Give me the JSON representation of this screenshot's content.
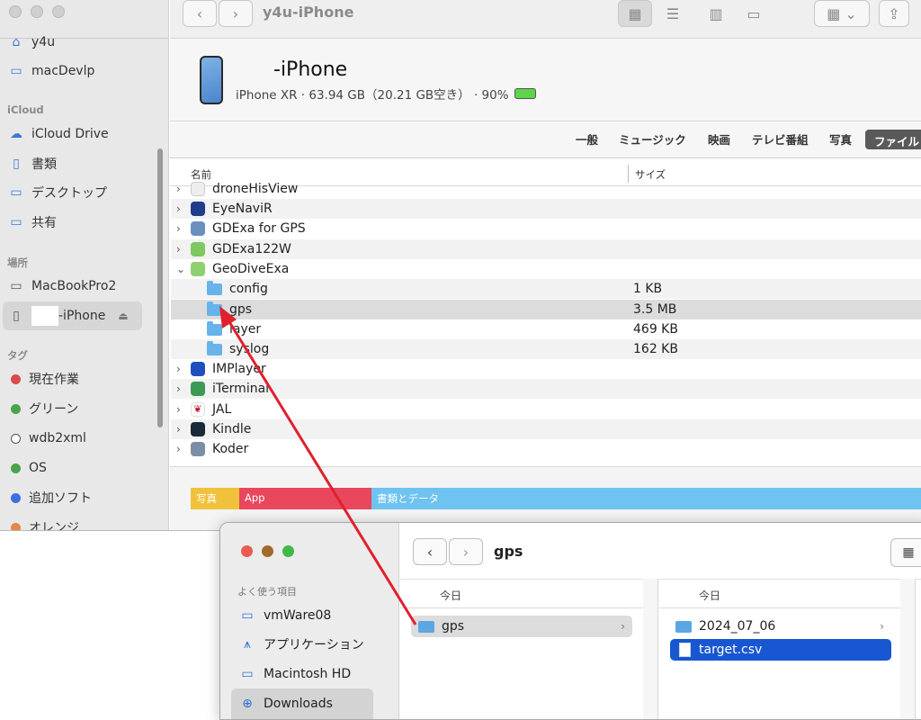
{
  "window1": {
    "title": "y4u-iPhone",
    "sidebar": {
      "top_items": [
        {
          "label": "y4u",
          "icon": "home-icon"
        },
        {
          "label": "macDevlp",
          "icon": "folder-icon"
        }
      ],
      "icloud_heading": "iCloud",
      "icloud_items": [
        {
          "label": "iCloud Drive",
          "icon": "cloud-icon"
        },
        {
          "label": "書類",
          "icon": "document-icon"
        },
        {
          "label": "デスクトップ",
          "icon": "desktop-icon"
        },
        {
          "label": "共有",
          "icon": "shared-folder-icon"
        }
      ],
      "locations_heading": "場所",
      "location_items": [
        {
          "label": "MacBookPro2",
          "icon": "laptop-icon"
        },
        {
          "label": "-iPhone",
          "icon": "iphone-icon"
        }
      ],
      "tags_heading": "タグ",
      "tags": [
        {
          "label": "現在作業",
          "color": "#d94b4b"
        },
        {
          "label": "グリーン",
          "color": "#4ca24c"
        },
        {
          "label": "wdb2xml",
          "color": "#ffffff"
        },
        {
          "label": "OS",
          "color": "#4ca24c"
        },
        {
          "label": "追加ソフト",
          "color": "#3d6fe0"
        },
        {
          "label": "オレンジ",
          "color": "#e2874a"
        }
      ]
    },
    "device": {
      "name": "-iPhone",
      "info": "iPhone XR · 63.94 GB（20.21 GB空き） · 90%"
    },
    "tabs": [
      "一般",
      "ミュージック",
      "映画",
      "テレビ番組",
      "写真",
      "ファイル"
    ],
    "columns": {
      "name": "名前",
      "size": "サイズ"
    },
    "rows": [
      {
        "label": "droneHisView",
        "size": "",
        "kind": "app"
      },
      {
        "label": "EyeNaviR",
        "size": "",
        "kind": "app"
      },
      {
        "label": "GDExa for GPS",
        "size": "",
        "kind": "app"
      },
      {
        "label": "GDExa122W",
        "size": "",
        "kind": "app"
      },
      {
        "label": "GeoDiveExa",
        "size": "",
        "kind": "app-open"
      },
      {
        "label": "config",
        "size": "1 KB",
        "kind": "folder"
      },
      {
        "label": "gps",
        "size": "3.5 MB",
        "kind": "folder"
      },
      {
        "label": "layer",
        "size": "469 KB",
        "kind": "folder"
      },
      {
        "label": "syslog",
        "size": "162 KB",
        "kind": "folder"
      },
      {
        "label": "IMPlayer",
        "size": "",
        "kind": "app"
      },
      {
        "label": "iTerminal",
        "size": "",
        "kind": "app"
      },
      {
        "label": "JAL",
        "size": "",
        "kind": "app"
      },
      {
        "label": "Kindle",
        "size": "",
        "kind": "app"
      },
      {
        "label": "Koder",
        "size": "",
        "kind": "app"
      }
    ],
    "storage": [
      {
        "label": "写真",
        "color": "#f0c23b"
      },
      {
        "label": "App",
        "color": "#e8475d"
      },
      {
        "label": "書類とデータ",
        "color": "#6ec3f0"
      }
    ]
  },
  "window2": {
    "title": "gps",
    "favorites_heading": "よく使う項目",
    "favorites": [
      {
        "label": "vmWare08",
        "icon": "folder-icon"
      },
      {
        "label": "アプリケーション",
        "icon": "applications-icon"
      },
      {
        "label": "Macintosh HD",
        "icon": "disk-icon"
      },
      {
        "label": "Downloads",
        "icon": "download-icon"
      }
    ],
    "col1": {
      "heading": "今日",
      "item": "gps"
    },
    "col2": {
      "heading": "今日",
      "items": [
        "2024_07_06",
        "target.csv"
      ]
    }
  }
}
